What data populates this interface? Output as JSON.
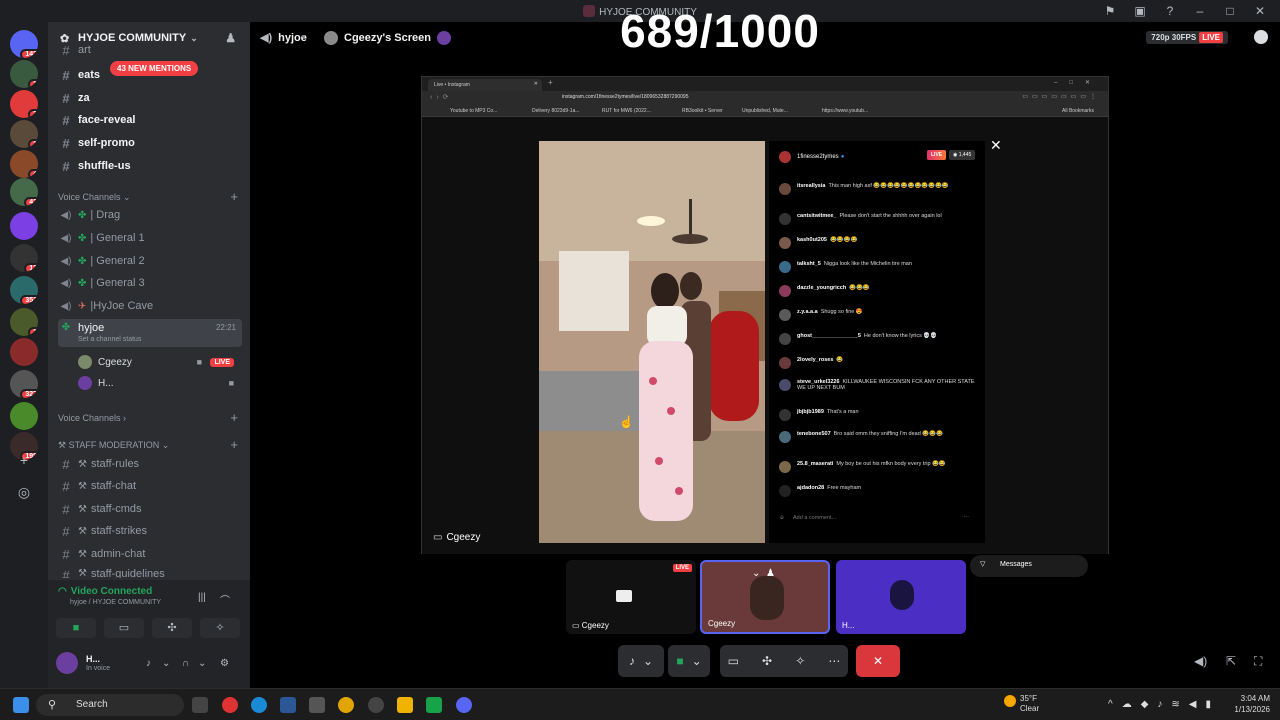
{
  "window": {
    "title": "HYJOE COMMUNITY"
  },
  "overlay": {
    "counter": "689/1000"
  },
  "server_badges": [
    "143",
    "1",
    "3",
    "1",
    "4",
    "43",
    "12",
    "353",
    "1",
    "327",
    "198"
  ],
  "server_header": {
    "name": "HYJOE COMMUNITY"
  },
  "mentions_pill": "43 NEW MENTIONS",
  "text_channels": [
    {
      "name": "art"
    },
    {
      "name": "eats"
    },
    {
      "name": "za"
    },
    {
      "name": "face-reveal"
    },
    {
      "name": "self-promo"
    },
    {
      "name": "shuffle-us"
    }
  ],
  "voice_category_1": "Voice Channels",
  "voice_channels": [
    {
      "name": "| Drag"
    },
    {
      "name": "| General 1"
    },
    {
      "name": "| General 2"
    },
    {
      "name": "| General 3"
    },
    {
      "name": "|HyJoe Cave"
    }
  ],
  "active_channel": {
    "name": "hyjoe",
    "time": "22:21",
    "status": "Set a channel status"
  },
  "voice_users": [
    {
      "name": "Cgeezy",
      "live": "LIVE"
    },
    {
      "name": "H..."
    }
  ],
  "voice_category_2": "Voice Channels",
  "staff_category": "STAFF MODERATION",
  "staff_channels": [
    {
      "name": "staff-rules"
    },
    {
      "name": "staff-chat"
    },
    {
      "name": "staff-cmds"
    },
    {
      "name": "staff-strikes"
    },
    {
      "name": "admin-chat"
    },
    {
      "name": "staff-guidelines"
    }
  ],
  "voice_panel": {
    "title": "Video Connected",
    "subtitle": "hyjoe / HYJOE COMMUNITY"
  },
  "user_panel": {
    "name": "H...",
    "status": "In voice"
  },
  "stage_header": {
    "channel": "hyjoe",
    "screen": "Cgeezy's Screen",
    "quality": "720p 30FPS",
    "live": "LIVE"
  },
  "browser": {
    "tab_title": "Live • Instagram",
    "url": "instagram.com/1finesse2tymes/live/18096532887290095",
    "bookmarks": [
      "Youtube to MP3 Co...",
      "Delivery 8023d9-1a...",
      "RUT for MW6 (2022...",
      "RB3oolkit • Server",
      "Unpublished, Mute...",
      "https://www.youtub...",
      "All Bookmarks"
    ]
  },
  "ig": {
    "host": "1finesse2tymes",
    "live": "LIVE",
    "views": "1,445",
    "comments": [
      {
        "user": "itsreallysia",
        "text": "This man high asf 😂😂😂😂😂😂😂😂😂😂😂"
      },
      {
        "user": "cantsitwitmee_",
        "text": "Please don't start the shhhh over again lol"
      },
      {
        "user": "kash0ut205",
        "text": "😂😂😂😂"
      },
      {
        "user": "talksht_5",
        "text": "Nigga look like the Michelin tire man"
      },
      {
        "user": "dazzle_youngricch",
        "text": "😂😂😂"
      },
      {
        "user": "z.y.a.a.a",
        "text": "Shugg so fine 😍"
      },
      {
        "user": "ghost_______________5",
        "text": "He don't know the lyrics 💀💀"
      },
      {
        "user": "2lovely_roses",
        "text": "😂"
      },
      {
        "user": "steve_urkel3226",
        "text": "KILLWAUKEE WISCONSIN FCK ANY OTHER STATE WE UP NEXT BUM"
      },
      {
        "user": "jbjbjb1989",
        "text": "That's a man"
      },
      {
        "user": "tenebone507",
        "text": "Bro said omm they sniffing I'm dead 😂😂😂"
      },
      {
        "user": "25.8_maserati",
        "text": "My boy be out his mfkn body every trip 😂😂"
      },
      {
        "user": "ajdadon28",
        "text": "Free mayham"
      }
    ],
    "input_placeholder": "Add a comment...",
    "messages_label": "Messages"
  },
  "screen_label": "Cgeezy",
  "tiles": [
    {
      "name": "Cgeezy",
      "live": "LIVE"
    },
    {
      "name": "Cgeezy"
    },
    {
      "name": "H..."
    }
  ],
  "taskbar": {
    "search": "Search",
    "weather_temp": "35°F",
    "weather_desc": "Clear",
    "time": "3:04 AM",
    "date": "1/13/2026"
  },
  "colors": {
    "discord_red": "#f23f43",
    "discord_green": "#23a55a",
    "blurple": "#5865f2"
  }
}
